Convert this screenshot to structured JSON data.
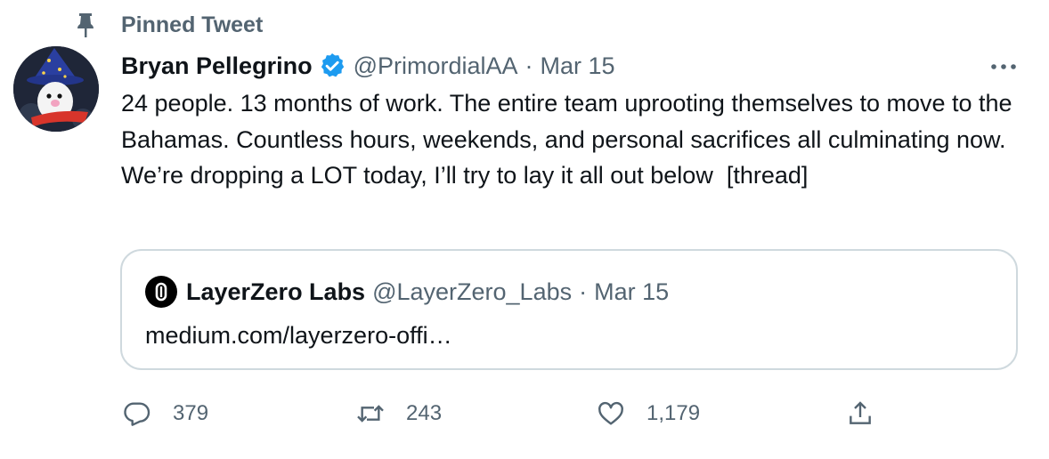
{
  "pinned": {
    "label": "Pinned Tweet",
    "icon": "pin-icon"
  },
  "tweet": {
    "author_name": "Bryan Pellegrino",
    "handle": "@PrimordialAA",
    "separator": "·",
    "date": "Mar 15",
    "verified": true,
    "text": "24 people. 13 months of work. The entire team uprooting themselves to move to the Bahamas. Countless hours, weekends, and personal sacrifices all culminating now. We’re dropping a LOT today, I’ll try to lay it all out below  [thread]"
  },
  "quote": {
    "author_name": "LayerZero Labs",
    "handle": "@LayerZero_Labs",
    "separator": "·",
    "date": "Mar 15",
    "text": "medium.com/layerzero-offi…"
  },
  "actions": {
    "replies": "379",
    "retweets": "243",
    "likes": "1,179"
  },
  "colors": {
    "verified": "#1d9bf0",
    "secondary_text": "#536471",
    "border": "#cfd9de"
  }
}
